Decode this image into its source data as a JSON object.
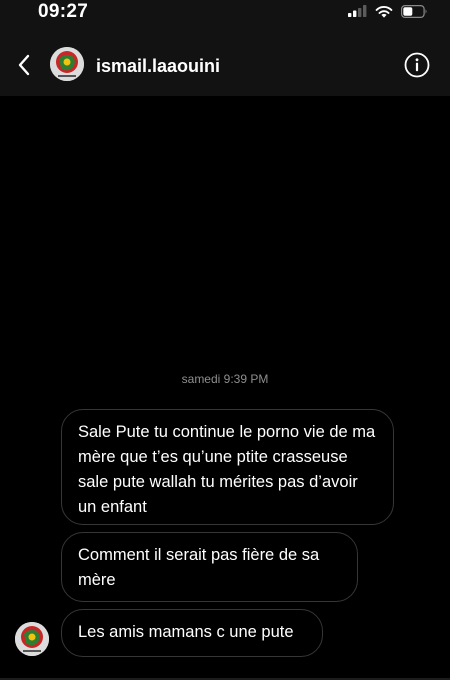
{
  "status_bar": {
    "time": "09:27",
    "icons": [
      "cellular-signal-icon",
      "wifi-icon",
      "battery-icon"
    ]
  },
  "header": {
    "back_icon": "chevron-left-icon",
    "username": "ismail.laaouini",
    "info_icon": "info-icon"
  },
  "thread": {
    "timestamp": "samedi 9:39 PM",
    "messages": [
      {
        "text": "Sale Pute tu continue le porno vie de ma mère que t’es qu’une ptite crasseuse sale pute wallah tu mérites pas d’avoir un enfant"
      },
      {
        "text": "Comment il serait pas fière de sa mère"
      },
      {
        "text": "Les amis mamans c une pute"
      }
    ]
  },
  "colors": {
    "background": "#000000",
    "header_background": "#121212",
    "bubble_border": "#363636",
    "timestamp_text": "#8e8e8e",
    "avatar_accent": "#c62828"
  }
}
